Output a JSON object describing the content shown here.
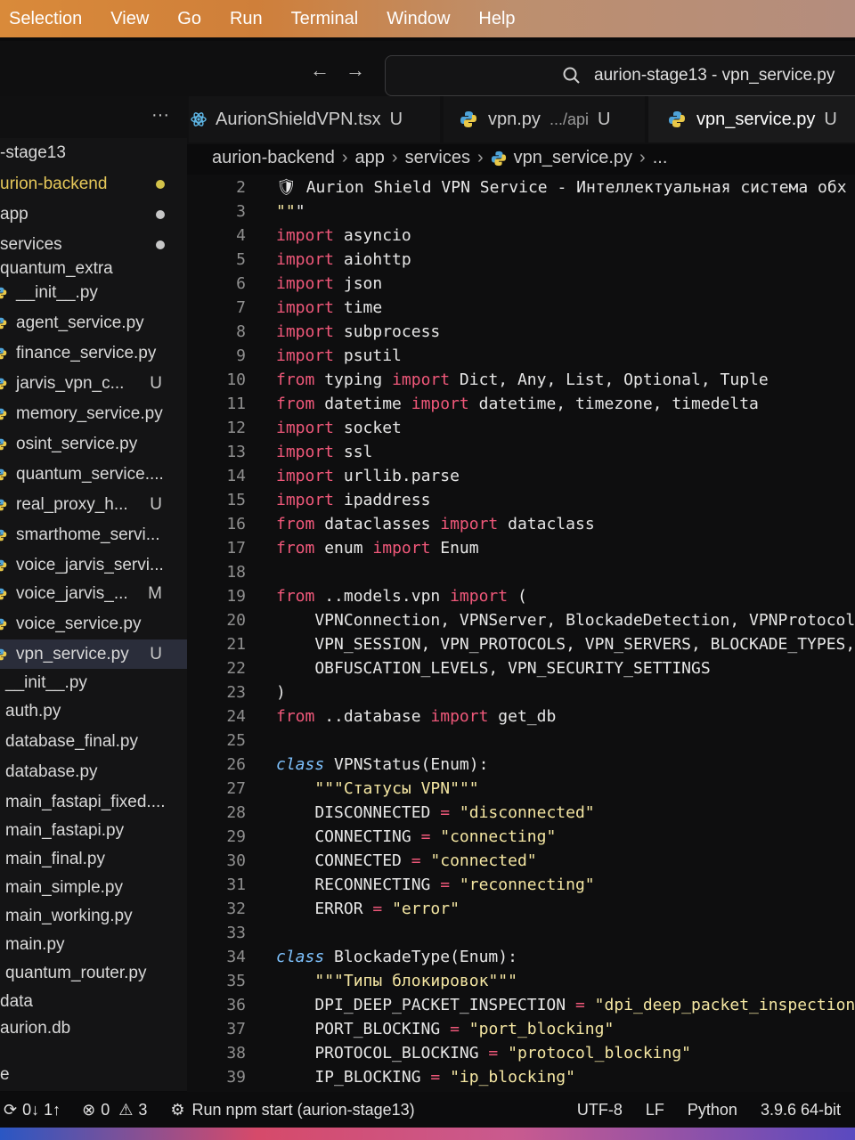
{
  "menu": [
    "Selection",
    "View",
    "Go",
    "Run",
    "Terminal",
    "Window",
    "Help"
  ],
  "nav": {
    "back_icon": "arrow-left-icon",
    "forward_icon": "arrow-right-icon"
  },
  "command_center": {
    "title": "aurion-stage13 - vpn_service.py",
    "icon": "search-icon"
  },
  "explorer": {
    "more": "···"
  },
  "tabs": [
    {
      "label": "AurionShieldVPN.tsx",
      "status": "U",
      "icon": "react-icon"
    },
    {
      "label": "vpn.py",
      "path": ".../api",
      "status": "U",
      "icon": "python-icon"
    },
    {
      "label": "vpn_service.py",
      "status": "U",
      "icon": "python-icon",
      "active": true
    }
  ],
  "breadcrumb": [
    "aurion-backend",
    "app",
    "services",
    "vpn_service.py",
    "..."
  ],
  "sidebar": {
    "items": [
      {
        "label": "-stage13"
      },
      {
        "label": "urion-backend",
        "dot": "#d3c34a",
        "color": "#e6c85a"
      },
      {
        "label": "app",
        "dot": "#c7c7c7"
      },
      {
        "label": "services",
        "dot": "#c7c7c7"
      },
      {
        "label": "quantum_extra"
      },
      {
        "label": "__init__.py"
      },
      {
        "label": "agent_service.py"
      },
      {
        "label": "finance_service.py"
      },
      {
        "label": "jarvis_vpn_c...",
        "badge": "U"
      },
      {
        "label": "memory_service.py"
      },
      {
        "label": "osint_service.py"
      },
      {
        "label": "quantum_service...."
      },
      {
        "label": "real_proxy_h...",
        "badge": "U"
      },
      {
        "label": "smarthome_servi..."
      },
      {
        "label": "voice_jarvis_servi..."
      },
      {
        "label": "voice_jarvis_...",
        "badge": "M"
      },
      {
        "label": "voice_service.py"
      },
      {
        "label": "vpn_service.py",
        "badge": "U",
        "active": true
      },
      {
        "label": "__init__.py"
      },
      {
        "label": "auth.py"
      },
      {
        "label": "database_final.py"
      },
      {
        "label": "database.py"
      },
      {
        "label": "main_fastapi_fixed...."
      },
      {
        "label": "main_fastapi.py"
      },
      {
        "label": "main_final.py"
      },
      {
        "label": "main_simple.py"
      },
      {
        "label": "main_working.py"
      },
      {
        "label": "main.py"
      },
      {
        "label": "quantum_router.py"
      },
      {
        "label": "data"
      },
      {
        "label": "aurion.db"
      },
      {
        "label": "e"
      }
    ]
  },
  "editor": {
    "line_numbers": [
      "2",
      "3",
      "4",
      "5",
      "6",
      "7",
      "8",
      "9",
      "10",
      "11",
      "12",
      "13",
      "14",
      "15",
      "16",
      "17",
      "18",
      "19",
      "20",
      "21",
      "22",
      "23",
      "24",
      "25",
      "26",
      "27",
      "28",
      "29",
      "30",
      "31",
      "32",
      "33",
      "34",
      "35",
      "36",
      "37",
      "38",
      "39"
    ],
    "lines": [
      "🛡 Aurion Shield VPN Service - Интеллектуальная система обх",
      "\"\"\"",
      "import asyncio",
      "import aiohttp",
      "import json",
      "import time",
      "import subprocess",
      "import psutil",
      "from typing import Dict, Any, List, Optional, Tuple",
      "from datetime import datetime, timezone, timedelta",
      "import socket",
      "import ssl",
      "import urllib.parse",
      "import ipaddress",
      "from dataclasses import dataclass",
      "from enum import Enum",
      "",
      "from ..models.vpn import (",
      "    VPNConnection, VPNServer, BlockadeDetection, VPNProtocol",
      "    VPN_SESSION, VPN_PROTOCOLS, VPN_SERVERS, BLOCKADE_TYPES,",
      "    OBFUSCATION_LEVELS, VPN_SECURITY_SETTINGS",
      ")",
      "from ..database import get_db",
      "",
      "class VPNStatus(Enum):",
      "    \"\"\"Статусы VPN\"\"\"",
      "    DISCONNECTED = \"disconnected\"",
      "    CONNECTING = \"connecting\"",
      "    CONNECTED = \"connected\"",
      "    RECONNECTING = \"reconnecting\"",
      "    ERROR = \"error\"",
      "",
      "class BlockadeType(Enum):",
      "    \"\"\"Типы блокировок\"\"\"",
      "    DPI_DEEP_PACKET_INSPECTION = \"dpi_deep_packet_inspection\"",
      "    PORT_BLOCKING = \"port_blocking\"",
      "    PROTOCOL_BLOCKING = \"protocol_blocking\"",
      "    IP_BLOCKING = \"ip_blocking\""
    ]
  },
  "status": {
    "sync": "0↓ 1↑",
    "errors": "0",
    "warnings": "3",
    "task": "Run npm start (aurion-stage13)",
    "encoding": "UTF-8",
    "eol": "LF",
    "language": "Python",
    "interpreter": "3.9.6 64-bit"
  },
  "colors": {
    "accent": "#2a2d3a",
    "keyword": "#f0587a",
    "module": "#b8e04a",
    "class": "#7fc3ff",
    "string": "#f4e6a2"
  }
}
